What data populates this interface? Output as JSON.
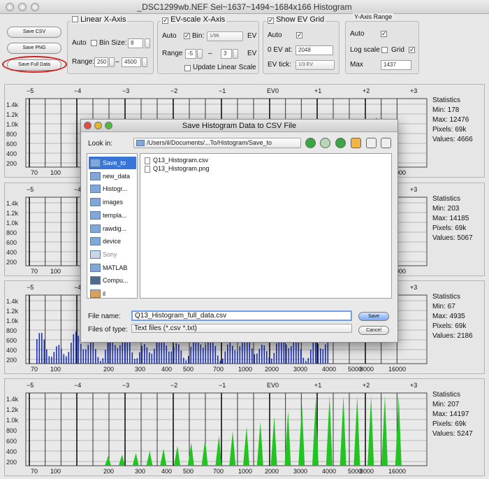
{
  "window": {
    "title": "_DSC1299wb.NEF Sel~1637~1494~1684x166 Histogram"
  },
  "buttons": {
    "save_csv": "Save CSV",
    "save_png": "Save PNG",
    "save_full": "Save Full Data"
  },
  "linear_axis": {
    "title": "Linear X-Axis",
    "auto_label": "Auto",
    "bin_size_label": "Bin Size:",
    "bin_size_value": "8",
    "range_label": "Range:",
    "range_min": "250",
    "range_sep": "–",
    "range_max": "4500"
  },
  "ev_axis": {
    "title": "EV-scale X-Axis",
    "auto_label": "Auto",
    "bin_label": "Bin:",
    "bin_value": "1/96",
    "bin_unit": "EV",
    "range_label": "Range",
    "range_min": "-5",
    "range_sep": "–",
    "range_max": "3",
    "range_unit": "EV",
    "update_label": "Update Linear Scale"
  },
  "ev_grid": {
    "title": "Show EV Grid",
    "auto_label": "Auto",
    "zero_ev_label": "0 EV at:",
    "zero_ev_value": "2048",
    "ev_tick_label": "EV tick:",
    "ev_tick_value": "1/3 EV"
  },
  "y_range": {
    "title": "Y-Axis Range",
    "auto_label": "Auto",
    "log_label": "Log scale",
    "grid_label": "Grid",
    "max_label": "Max",
    "max_value": "1437"
  },
  "axis": {
    "ev_ticks": [
      "−5",
      "−4",
      "−3",
      "−2",
      "−1",
      "EV0",
      "+1",
      "+2",
      "+3"
    ],
    "y_ticks": [
      "1.4k",
      "1.2k",
      "1.0k",
      "800",
      "600",
      "400",
      "200"
    ],
    "lin_ticks": [
      "70",
      "100",
      "200",
      "300",
      "400",
      "500",
      "700",
      "1000",
      "2000",
      "3000",
      "4000",
      "5000",
      "8000",
      "16000"
    ]
  },
  "panels": [
    {
      "stats": {
        "header": "Statistics",
        "min": "Min: 178",
        "max": "Max: 12476",
        "pixels": "Pixels: 69k",
        "values": "Values: 4666"
      },
      "color": "#d01818"
    },
    {
      "stats": {
        "header": "Statistics",
        "min": "Min: 203",
        "max": "Max: 14185",
        "pixels": "Pixels: 69k",
        "values": "Values: 5067"
      },
      "color": "#888888"
    },
    {
      "stats": {
        "header": "Statistics",
        "min": "Min: 67",
        "max": "Max: 4935",
        "pixels": "Pixels: 69k",
        "values": "Values: 2186"
      },
      "color": "#1a2fb8"
    },
    {
      "stats": {
        "header": "Statistics",
        "min": "Min: 207",
        "max": "Max: 14197",
        "pixels": "Pixels: 69k",
        "values": "Values: 5247"
      },
      "color": "#22c422"
    }
  ],
  "dialog": {
    "title": "Save Histogram Data to CSV File",
    "look_in_label": "Look in:",
    "look_in_value": "/Users/il/Documents/...To/Histogram/Save_to",
    "places": [
      "Save_to",
      "new_data",
      "Histogr...",
      "images",
      "templa...",
      "rawdig...",
      "device",
      "Sony",
      "MATLAB",
      "Compu...",
      "il"
    ],
    "files": [
      "Q13_Histogram.csv",
      "Q13_Histogram.png"
    ],
    "file_name_label": "File name:",
    "file_name_value": "Q13_Histogram_full_data.csv",
    "file_type_label": "Files of type:",
    "file_type_value": "Text files (*.csv *.txt)",
    "save_label": "Save",
    "cancel_label": "Cancel"
  }
}
